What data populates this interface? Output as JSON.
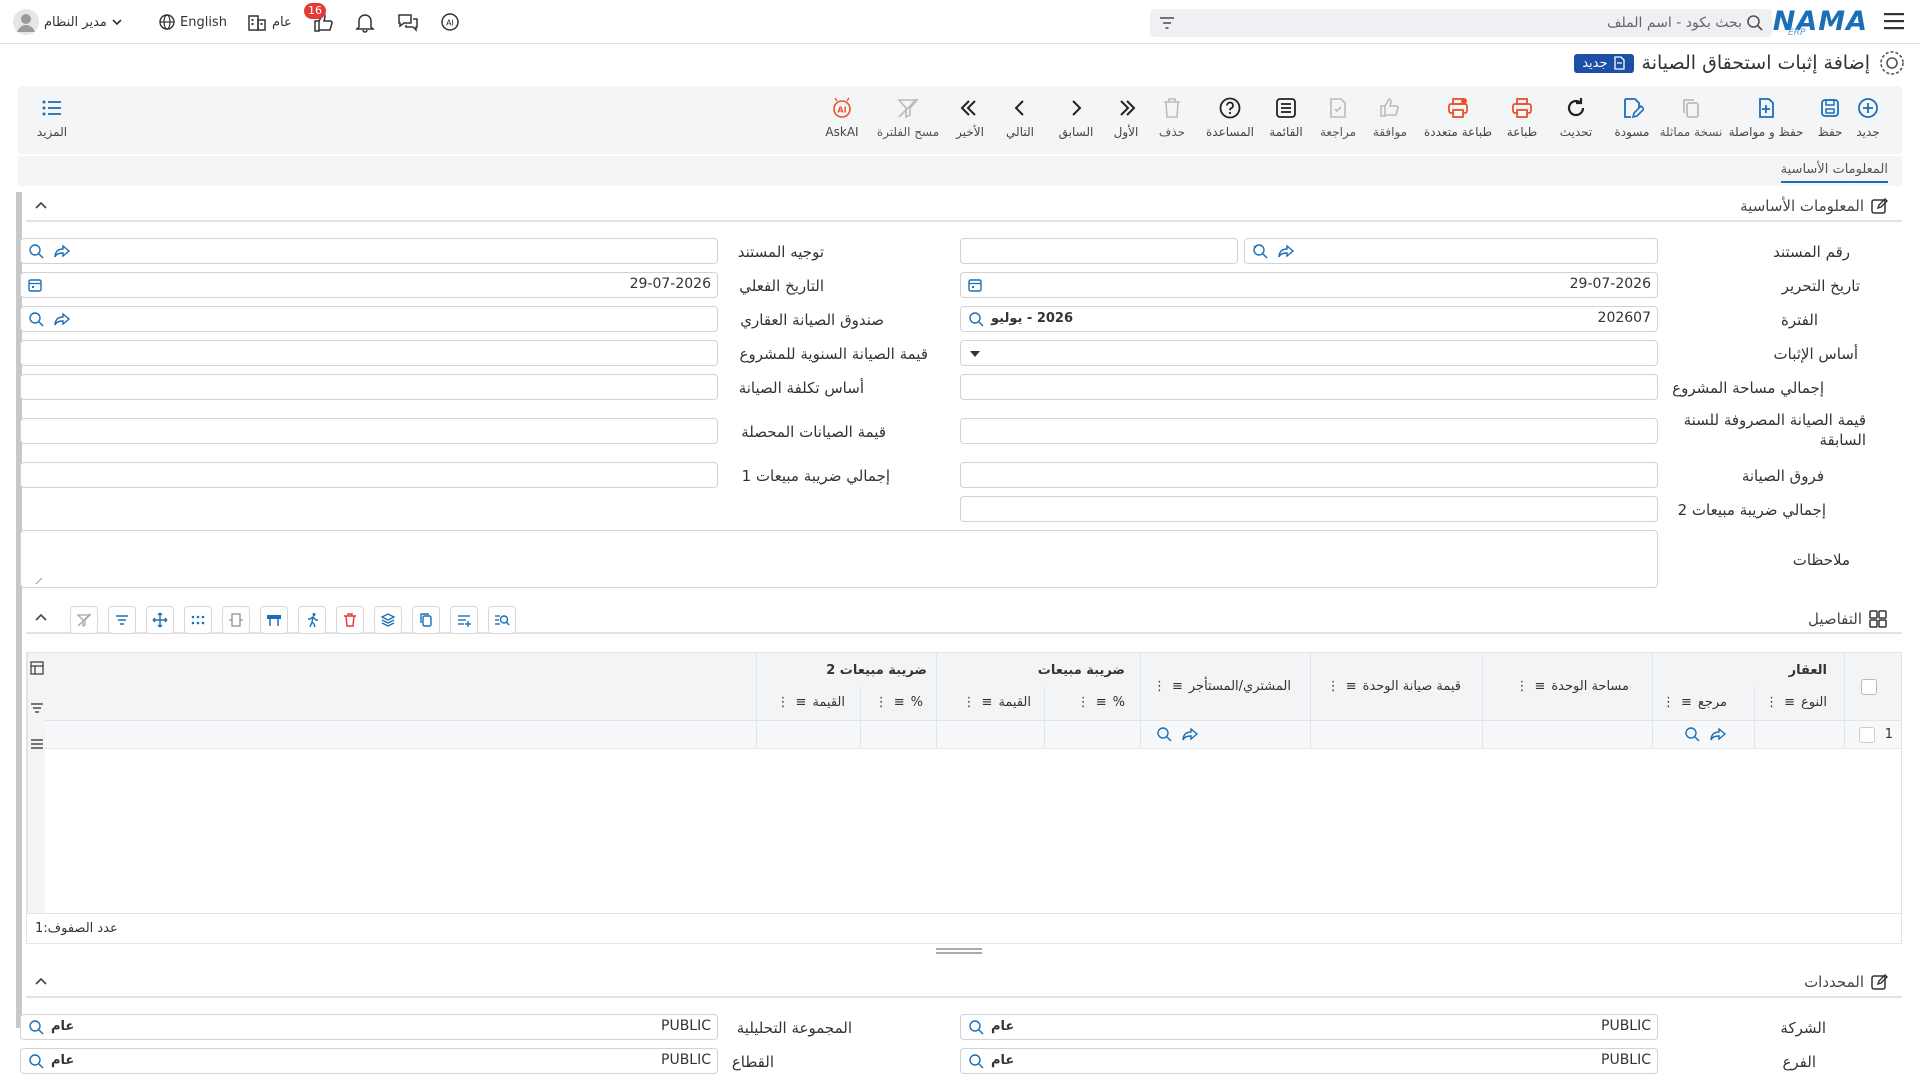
{
  "header": {
    "logo_text": "NAMA",
    "logo_sub": "ERP",
    "search_placeholder": "بحث بكود - اسم الملف",
    "notifications_count": "16",
    "public_label": "عام",
    "language_label": "English",
    "user_name": "مدير النظام"
  },
  "page": {
    "title": "إضافة إثبات استحقاق الصيانة",
    "status_badge": "جديد"
  },
  "toolbar": {
    "items": [
      {
        "label": "جديد",
        "icon": "plus-circle-icon"
      },
      {
        "label": "حفظ",
        "icon": "save-icon"
      },
      {
        "label": "حفظ و مواصلة",
        "icon": "save-continue-icon"
      },
      {
        "label": "نسخة مماثلة",
        "icon": "copy-icon"
      },
      {
        "label": "مسودة",
        "icon": "draft-icon"
      },
      {
        "label": "تحديث",
        "icon": "refresh-icon"
      },
      {
        "label": "طباعة",
        "icon": "print-icon"
      },
      {
        "label": "طباعة متعددة",
        "icon": "multi-print-icon"
      },
      {
        "label": "موافقة",
        "icon": "thumbs-up-icon"
      },
      {
        "label": "مراجعة",
        "icon": "review-icon"
      },
      {
        "label": "القائمة",
        "icon": "list-icon"
      },
      {
        "label": "المساعدة",
        "icon": "help-icon"
      },
      {
        "label": "حذف",
        "icon": "trash-icon"
      },
      {
        "label": "الأول",
        "icon": "first-icon"
      },
      {
        "label": "السابق",
        "icon": "previous-icon"
      },
      {
        "label": "التالي",
        "icon": "next-icon"
      },
      {
        "label": "الأخير",
        "icon": "last-icon"
      },
      {
        "label": "مسح الفلترة",
        "icon": "clear-filter-icon"
      },
      {
        "label": "AskAI",
        "icon": "ai-icon"
      }
    ],
    "more_label": "المزيد"
  },
  "tabs": {
    "basic_info": "المعلومات الأساسية"
  },
  "basic_section": {
    "title": "المعلومات الأساسية",
    "doc_number_label": "رقم المستند",
    "doc_direction_label": "توجيه المستند",
    "edit_date_label": "تاريخ التحرير",
    "edit_date_value": "29-07-2026",
    "actual_date_label": "التاريخ الفعلي",
    "actual_date_value": "29-07-2026",
    "period_label": "الفترة",
    "period_code": "202607",
    "period_name": "2026 - يوليو",
    "fund_label": "صندوق الصيانة العقاري",
    "basis_label": "أساس الإثبات",
    "annual_value_label": "قيمة الصيانة السنوية للمشروع",
    "total_area_label": "إجمالي مساحة المشروع",
    "cost_basis_label": "أساس تكلفة الصيانة",
    "prev_year_label": "قيمة الصيانة المصروفة للسنة السابقة",
    "collected_label": "قيمة الصيانات المحصلة",
    "diff_label": "فروق الصيانة",
    "vat1_label": "إجمالي ضريبة مبيعات 1",
    "vat2_label": "إجمالي ضريبة مبيعات 2",
    "notes_label": "ملاحظات"
  },
  "details_section": {
    "title": "التفاصيل",
    "columns": {
      "property": "العقار",
      "type": "النوع",
      "ref": "مرجع",
      "unit_area": "مساحة الوحدة",
      "unit_maint_value": "قيمة صيانة الوحدة",
      "buyer_tenant": "المشتري/المستأجر",
      "vat": "ضريبة مبيعات",
      "vat2": "ضريبة مبيعات 2",
      "percent": "%",
      "value": "القيمة"
    },
    "rows": [
      {
        "num": "1"
      }
    ],
    "row_count_label": "عدد الصفوف:",
    "row_count": "1"
  },
  "dimensions_section": {
    "title": "المحددات",
    "company_label": "الشركة",
    "company_code": "PUBLIC",
    "company_name": "عام",
    "analytic_group_label": "المجموعة التحليلية",
    "analytic_group_code": "PUBLIC",
    "analytic_group_name": "عام",
    "branch_label": "الفرع",
    "branch_code": "PUBLIC",
    "branch_name": "عام",
    "sector_label": "القطاع",
    "sector_code": "PUBLIC",
    "sector_name": "عام"
  }
}
